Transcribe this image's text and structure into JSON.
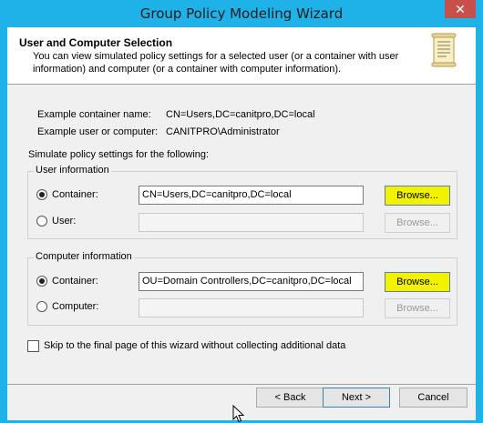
{
  "window": {
    "title": "Group Policy Modeling Wizard",
    "close_glyph": "✕"
  },
  "header": {
    "title": "User and Computer Selection",
    "description": "You can view simulated policy settings for a selected user (or a container with user information) and computer (or a container with computer information).",
    "icon": "scroll-icon"
  },
  "examples": {
    "container_label": "Example container name:",
    "container_value": "CN=Users,DC=canitpro,DC=local",
    "user_label": "Example user or computer:",
    "user_value": "CANITPRO\\Administrator"
  },
  "simulate_label": "Simulate policy settings for the following:",
  "user_info": {
    "legend": "User information",
    "container_label": "Container:",
    "container_value": "CN=Users,DC=canitpro,DC=local",
    "container_checked": true,
    "browse_label": "Browse...",
    "user_label": "User:",
    "user_value": "",
    "user_browse_label": "Browse..."
  },
  "computer_info": {
    "legend": "Computer information",
    "container_label": "Container:",
    "container_value": "OU=Domain Controllers,DC=canitpro,DC=local",
    "container_checked": true,
    "browse_label": "Browse...",
    "computer_label": "Computer:",
    "computer_value": "",
    "computer_browse_label": "Browse..."
  },
  "skip_label": "Skip to the final page of this wizard without collecting additional data",
  "skip_checked": false,
  "buttons": {
    "back": "< Back",
    "next": "Next >",
    "cancel": "Cancel"
  },
  "colors": {
    "title_bar": "#1fb2e8",
    "close_button": "#c7504b",
    "highlight": "#f2f200"
  }
}
